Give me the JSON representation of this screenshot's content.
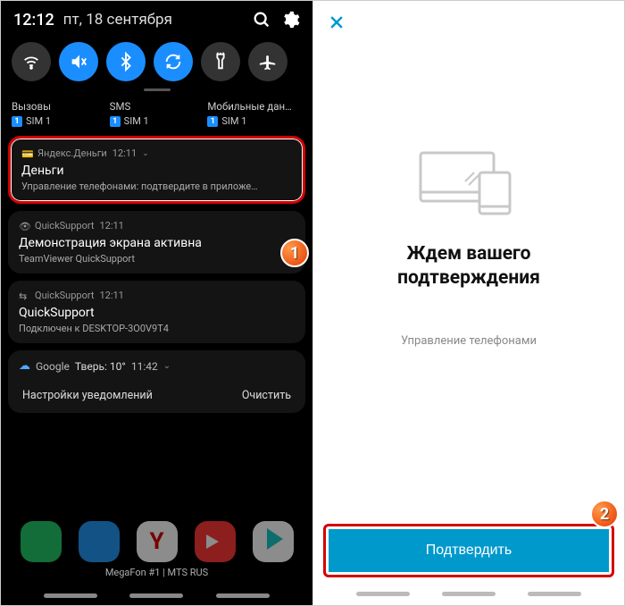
{
  "status": {
    "time": "12:12",
    "date": "пт, 18 сентября"
  },
  "qs_icons": [
    "wifi",
    "sound-mute",
    "bluetooth",
    "rotate",
    "flashlight",
    "airplane"
  ],
  "sim": [
    {
      "label": "Вызовы",
      "badge": "1",
      "name": "SIM 1"
    },
    {
      "label": "SMS",
      "badge": "1",
      "name": "SIM 1"
    },
    {
      "label": "Мобильные дан…",
      "badge": "1",
      "name": "SIM 1"
    }
  ],
  "notifications": [
    {
      "app": "Яндекс.Деньги",
      "time": "12:11",
      "title": "Деньги",
      "body": "Управление телефонами: подтвердите в приложе…",
      "highlight": true
    },
    {
      "app": "QuickSupport",
      "time": "12:11",
      "title": "Демонстрация экрана активна",
      "body": "TeamViewer QuickSupport",
      "highlight": false
    },
    {
      "app": "QuickSupport",
      "time": "12:11",
      "title": "QuickSupport",
      "body": "Подключен к DESKTOP-3O0V9T4",
      "highlight": false
    }
  ],
  "weather": {
    "provider": "Google",
    "text": "Тверь: 10°",
    "time": "11:42"
  },
  "actions": {
    "settings": "Настройки уведомлений",
    "clear": "Очистить"
  },
  "carrier": "MegaFon #1 | MTS RUS",
  "step_badges": {
    "one": "1",
    "two": "2"
  },
  "right": {
    "title_l1": "Ждем вашего",
    "title_l2": "подтверждения",
    "subtitle": "Управление телефонами",
    "confirm": "Подтвердить"
  }
}
